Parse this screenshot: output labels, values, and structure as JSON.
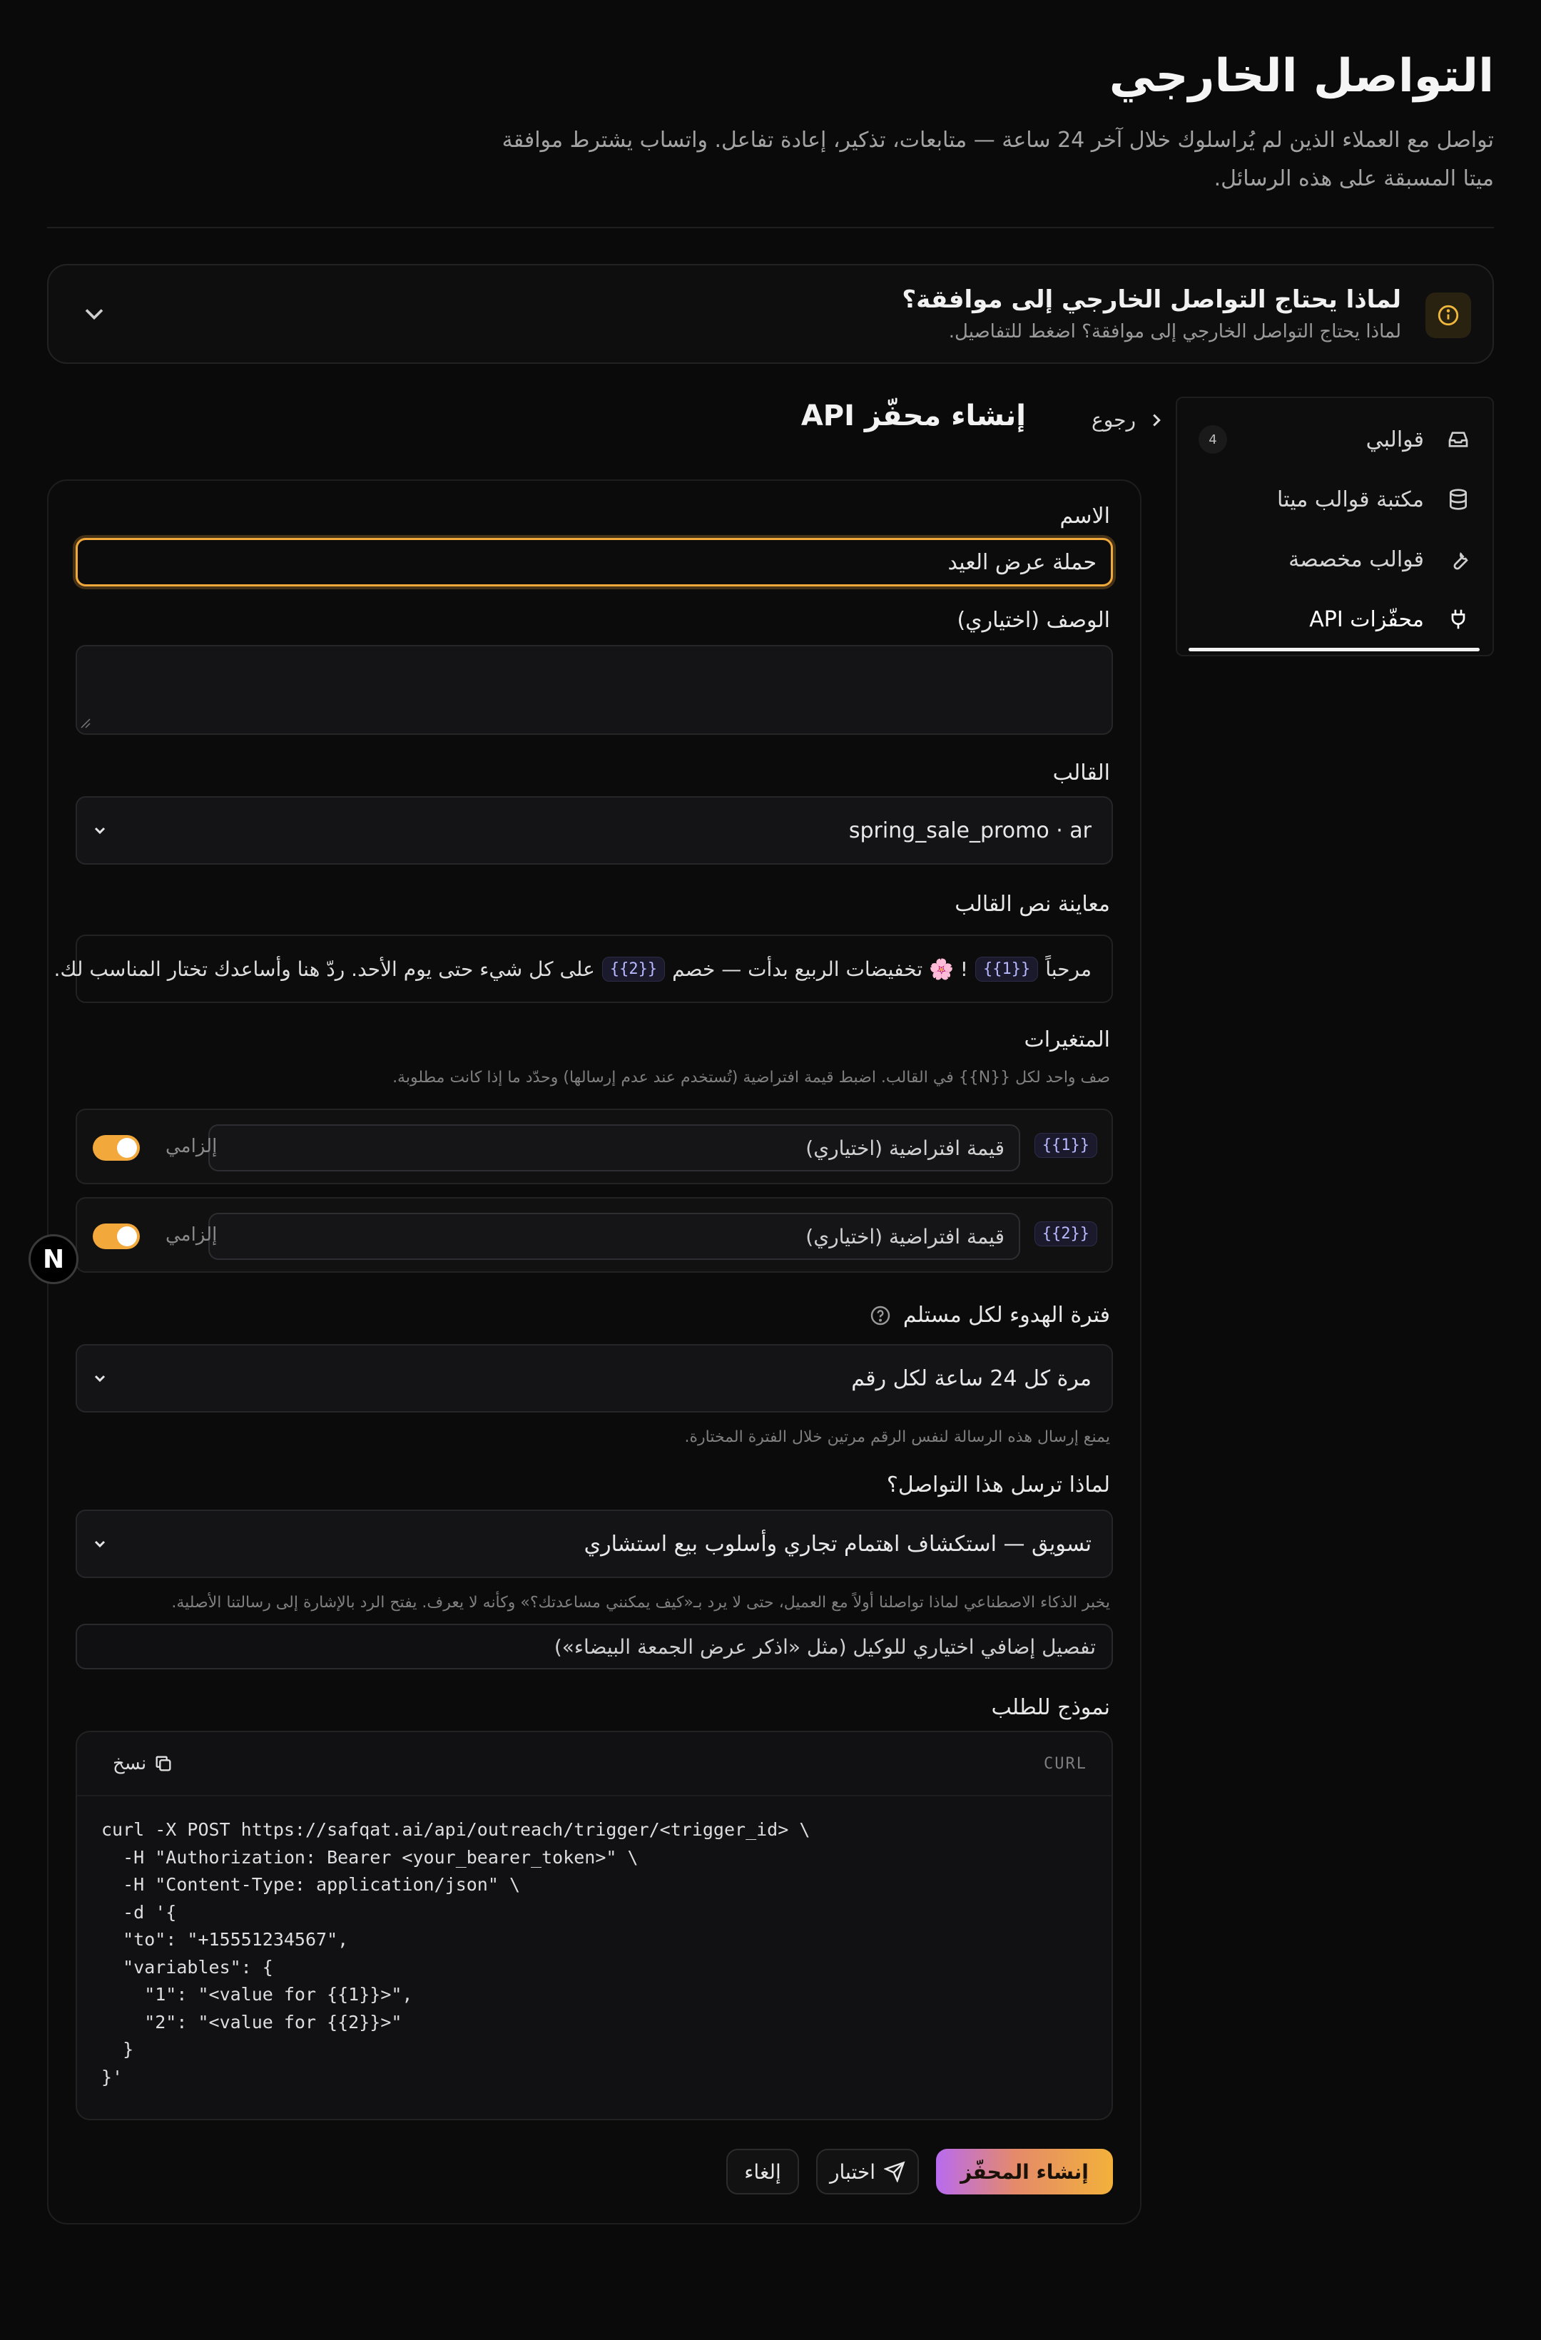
{
  "header": {
    "title": "التواصل الخارجي",
    "subtitle": "تواصل مع العملاء الذين لم يُراسلوك خلال آخر 24 ساعة — متابعات، تذكير، إعادة تفاعل. واتساب يشترط موافقة ميتا المسبقة على هذه الرسائل."
  },
  "why": {
    "title": "لماذا يحتاج التواصل الخارجي إلى موافقة؟",
    "subtitle": "لماذا يحتاج التواصل الخارجي إلى موافقة؟ اضغط للتفاصيل.",
    "icon": "info-icon"
  },
  "sidebar": {
    "items": [
      {
        "label": "قوالبي",
        "icon": "inbox-icon",
        "badge": "4"
      },
      {
        "label": "مكتبة قوالب ميتا",
        "icon": "database-icon"
      },
      {
        "label": "قوالب مخصصة",
        "icon": "wrench-icon"
      },
      {
        "label": "محفّزات API",
        "icon": "plug-icon",
        "active": true
      }
    ]
  },
  "page": {
    "back_label": "رجوع",
    "heading": "إنشاء محفّز API"
  },
  "form": {
    "name_label": "الاسم",
    "name_value": "حملة عرض العيد",
    "desc_label": "الوصف (اختياري)",
    "template_label": "القالب",
    "template_value": "spring_sale_promo · ar",
    "preview_label": "معاينة نص القالب",
    "preview": {
      "part1": "مرحباً",
      "var1": "{{1}}",
      "part2": "! 🌸 تخفيضات الربيع بدأت — خصم",
      "var2": "{{2}}",
      "part3": "على كل شيء حتى يوم الأحد. ردّ هنا وأساعدك تختار المناسب لك."
    },
    "variables_label": "المتغيرات",
    "variables_help": "صف واحد لكل {{N}} في القالب. اضبط قيمة افتراضية (تُستخدم عند عدم إرسالها) وحدّد ما إذا كانت مطلوبة.",
    "variables": [
      {
        "chip": "{{1}}",
        "placeholder": "قيمة افتراضية (اختياري)",
        "required_label": "إلزامي",
        "required": true
      },
      {
        "chip": "{{2}}",
        "placeholder": "قيمة افتراضية (اختياري)",
        "required_label": "إلزامي",
        "required": true
      }
    ],
    "cooldown_label": "فترة الهدوء لكل مستلم",
    "cooldown_value": "مرة كل 24 ساعة لكل رقم",
    "cooldown_help": "يمنع إرسال هذه الرسالة لنفس الرقم مرتين خلال الفترة المختارة.",
    "reason_label": "لماذا ترسل هذا التواصل؟",
    "reason_value": "تسويق — استكشاف اهتمام تجاري وأسلوب بيع استشاري",
    "reason_help": "يخبر الذكاء الاصطناعي لماذا تواصلنا أولاً مع العميل، حتى لا يرد بـ«كيف يمكنني مساعدتك؟» وكأنه لا يعرف. يفتح الرد بالإشارة إلى رسالتنا الأصلية.",
    "extra_placeholder": "تفصيل إضافي اختياري للوكيل (مثل «اذكر عرض الجمعة البيضاء»)",
    "request_label": "نموذج للطلب"
  },
  "code": {
    "lang": "CURL",
    "copy_label": "نسخ",
    "text": "curl -X POST https://safqat.ai/api/outreach/trigger/<trigger_id> \\\n  -H \"Authorization: Bearer <your_bearer_token>\" \\\n  -H \"Content-Type: application/json\" \\\n  -d '{\n  \"to\": \"+15551234567\",\n  \"variables\": {\n    \"1\": \"<value for {{1}}>\",\n    \"2\": \"<value for {{2}}>\"\n  }\n}'"
  },
  "actions": {
    "create_label": "إنشاء المحفّز",
    "test_label": "اختبار",
    "cancel_label": "إلغاء"
  },
  "fab": {
    "letter": "N"
  },
  "colors": {
    "accent": "#f2a93b",
    "toggle_on": "#f2a83a"
  }
}
